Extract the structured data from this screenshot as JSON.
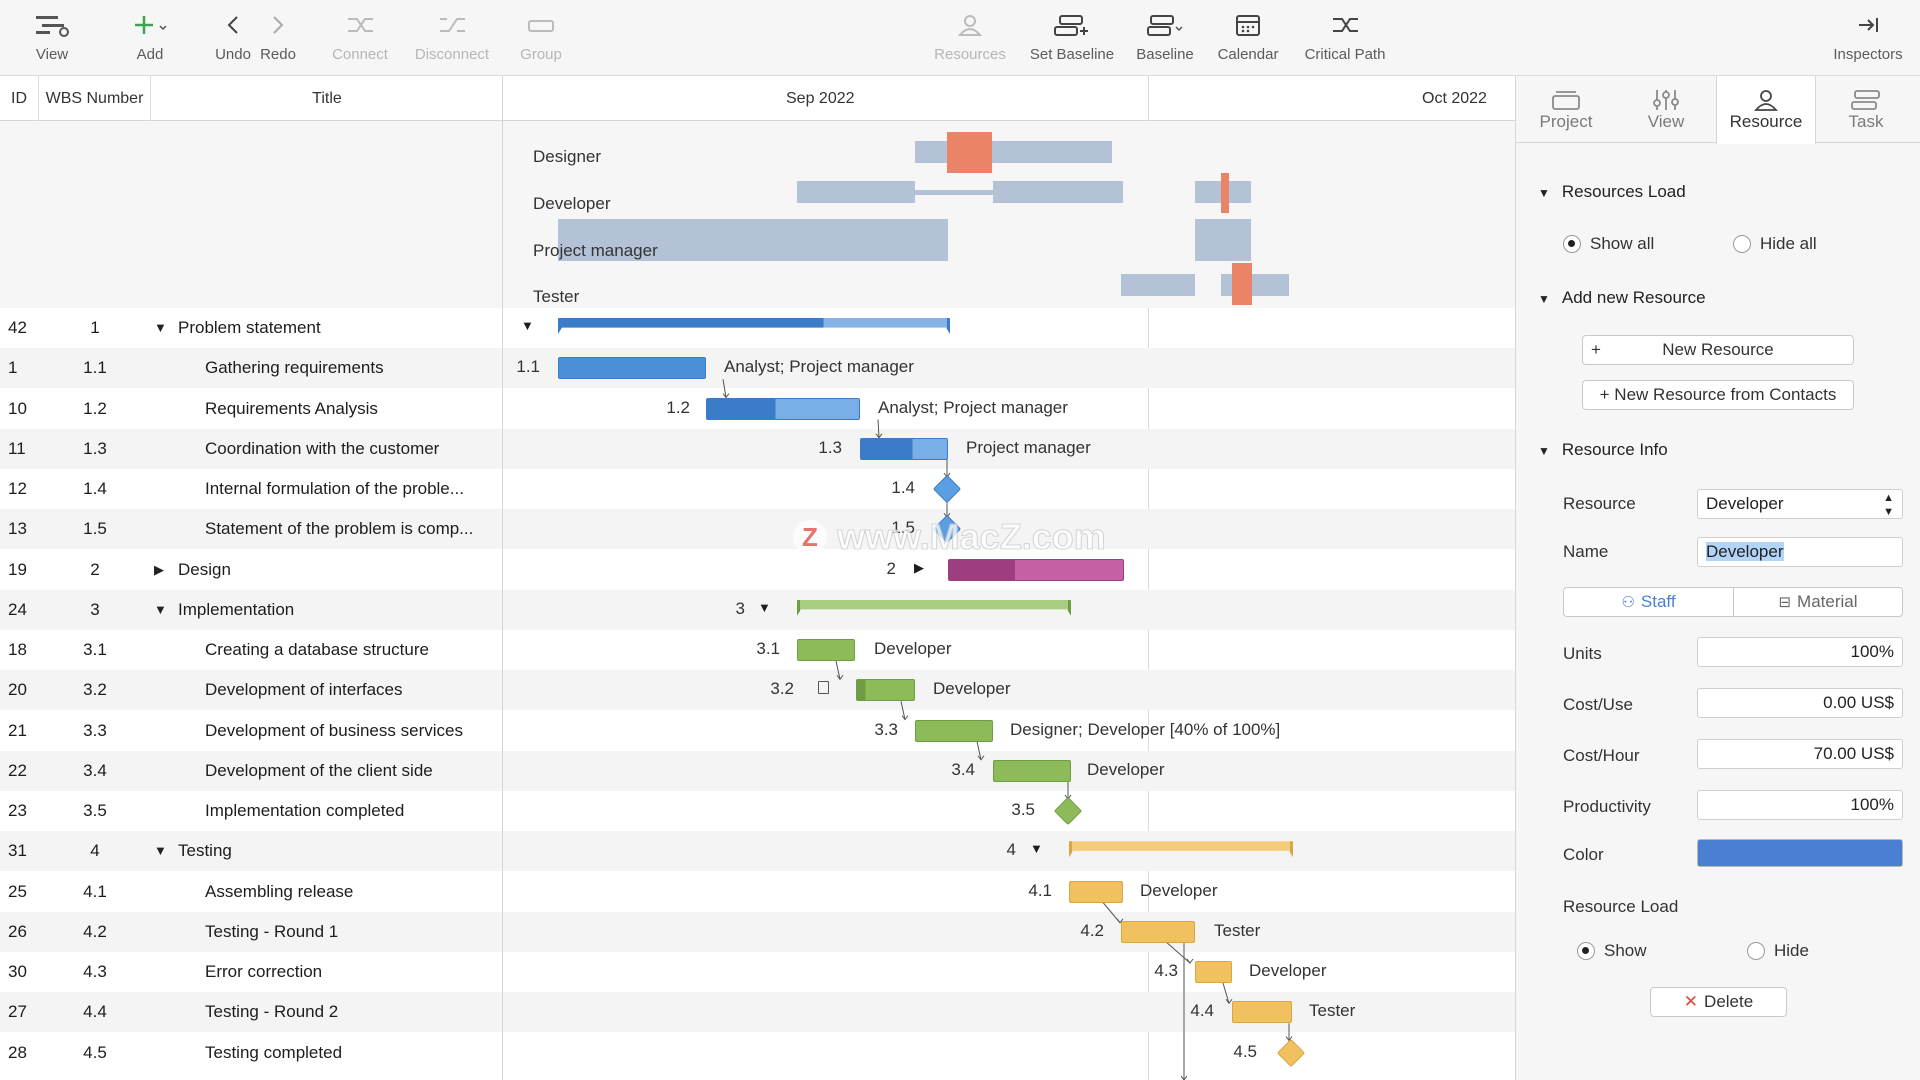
{
  "toolbar": {
    "view": "View",
    "add": "Add",
    "undo": "Undo",
    "redo": "Redo",
    "connect": "Connect",
    "disconnect": "Disconnect",
    "group": "Group",
    "resources": "Resources",
    "set_baseline": "Set Baseline",
    "baseline": "Baseline",
    "calendar": "Calendar",
    "critical_path": "Critical Path",
    "inspectors": "Inspectors"
  },
  "table": {
    "headers": {
      "id": "ID",
      "wbs": "WBS Number",
      "title": "Title"
    },
    "rows": [
      {
        "id": "42",
        "wbs": "1",
        "title": "Problem statement",
        "group": true,
        "expanded": true
      },
      {
        "id": "1",
        "wbs": "1.1",
        "title": "Gathering requirements"
      },
      {
        "id": "10",
        "wbs": "1.2",
        "title": "Requirements Analysis"
      },
      {
        "id": "11",
        "wbs": "1.3",
        "title": "Coordination with the customer"
      },
      {
        "id": "12",
        "wbs": "1.4",
        "title": "Internal formulation of the proble..."
      },
      {
        "id": "13",
        "wbs": "1.5",
        "title": "Statement of the problem is comp..."
      },
      {
        "id": "19",
        "wbs": "2",
        "title": "Design",
        "group": true,
        "expanded": false
      },
      {
        "id": "24",
        "wbs": "3",
        "title": "Implementation",
        "group": true,
        "expanded": true
      },
      {
        "id": "18",
        "wbs": "3.1",
        "title": "Creating a database structure"
      },
      {
        "id": "20",
        "wbs": "3.2",
        "title": "Development of interfaces"
      },
      {
        "id": "21",
        "wbs": "3.3",
        "title": "Development of business services"
      },
      {
        "id": "22",
        "wbs": "3.4",
        "title": "Development of the client side"
      },
      {
        "id": "23",
        "wbs": "3.5",
        "title": "Implementation completed"
      },
      {
        "id": "31",
        "wbs": "4",
        "title": "Testing",
        "group": true,
        "expanded": true
      },
      {
        "id": "25",
        "wbs": "4.1",
        "title": "Assembling release"
      },
      {
        "id": "26",
        "wbs": "4.2",
        "title": "Testing - Round 1"
      },
      {
        "id": "30",
        "wbs": "4.3",
        "title": "Error correction"
      },
      {
        "id": "27",
        "wbs": "4.4",
        "title": "Testing - Round 2"
      },
      {
        "id": "28",
        "wbs": "4.5",
        "title": "Testing completed"
      }
    ]
  },
  "gantt": {
    "months": [
      "Sep 2022",
      "Oct 2022"
    ],
    "resources": [
      "Designer",
      "Developer",
      "Project manager",
      "Tester"
    ],
    "task_labels": {
      "t11": "Analyst; Project manager",
      "t12": "Analyst; Project manager",
      "t13": "Project manager",
      "t31": "Developer",
      "t32": "Developer",
      "t33": "Designer; Developer [40% of 100%]",
      "t34": "Developer",
      "t41": "Developer",
      "t42": "Tester",
      "t43": "Developer",
      "t44": "Tester"
    },
    "wbs_labels": {
      "w11": "1.1",
      "w12": "1.2",
      "w13": "1.3",
      "w14": "1.4",
      "w15": "1.5",
      "w2": "2",
      "w3": "3",
      "w31": "3.1",
      "w32": "3.2",
      "w33": "3.3",
      "w34": "3.4",
      "w35": "3.5",
      "w4": "4",
      "w41": "4.1",
      "w42": "4.2",
      "w43": "4.3",
      "w44": "4.4",
      "w45": "4.5"
    },
    "watermark": "www.MacZ.com",
    "colors": {
      "blue": "#4a8fd8",
      "green": "#8dbb5a",
      "orange": "#f0c15e",
      "purple": "#c560a5",
      "load": "#b4c2d8",
      "overload": "#e98468"
    }
  },
  "inspector": {
    "tabs": [
      "Project",
      "View",
      "Resource",
      "Task"
    ],
    "active_tab": "Resource",
    "resources_load": {
      "title": "Resources Load",
      "show_all": "Show all",
      "hide_all": "Hide all"
    },
    "add_new": {
      "title": "Add new Resource",
      "new_resource": "New Resource",
      "from_contacts": "+ New Resource from Contacts"
    },
    "info": {
      "title": "Resource Info",
      "resource_label": "Resource",
      "resource_value": "Developer",
      "name_label": "Name",
      "name_value": "Developer",
      "staff": "Staff",
      "material": "Material",
      "units_label": "Units",
      "units_value": "100%",
      "cost_use_label": "Cost/Use",
      "cost_use_value": "0.00 US$",
      "cost_hour_label": "Cost/Hour",
      "cost_hour_value": "70.00 US$",
      "productivity_label": "Productivity",
      "productivity_value": "100%",
      "color_label": "Color",
      "color_value": "#4a7fd4",
      "resource_load_label": "Resource Load",
      "show": "Show",
      "hide": "Hide",
      "delete": "Delete"
    }
  }
}
